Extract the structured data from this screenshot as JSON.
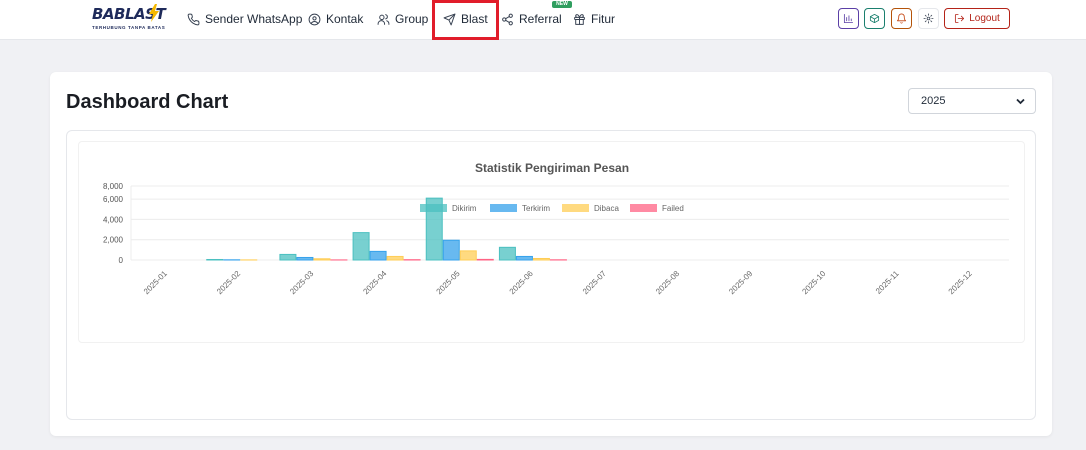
{
  "brand": {
    "name": "BABLAST",
    "tagline": "TERHUBUNG TANPA BATAS"
  },
  "nav": {
    "items": [
      {
        "label": "Sender WhatsApp",
        "icon": "phone-icon"
      },
      {
        "label": "Kontak",
        "icon": "user-circle-icon"
      },
      {
        "label": "Group",
        "icon": "users-icon"
      },
      {
        "label": "Blast",
        "icon": "send-icon"
      },
      {
        "label": "Referral",
        "icon": "share-icon"
      },
      {
        "label": "Fitur",
        "icon": "gift-icon"
      }
    ],
    "new_badge": "NEW"
  },
  "toolbar": {
    "chart_icon": "bar-chart-icon",
    "package_icon": "package-icon",
    "bell_icon": "bell-icon",
    "settings_icon": "gear-icon",
    "logout_label": "Logout",
    "colors": {
      "chart": "#5b3fa6",
      "package": "#1a7f6e",
      "bell": "#b45309",
      "settings": "#374151",
      "logout": "#b42318"
    }
  },
  "dashboard": {
    "title": "Dashboard Chart",
    "year_selected": "2025"
  },
  "chart_data": {
    "type": "bar",
    "title": "Statistik Pengiriman Pesan",
    "categories": [
      "2025-01",
      "2025-02",
      "2025-03",
      "2025-04",
      "2025-05",
      "2025-06",
      "2025-07",
      "2025-08",
      "2025-09",
      "2025-10",
      "2025-11",
      "2025-12"
    ],
    "series": [
      {
        "name": "Dikirim",
        "color": "#4bc0c0",
        "values": [
          0,
          50,
          550,
          2700,
          6100,
          1250,
          0,
          0,
          0,
          0,
          0,
          0
        ]
      },
      {
        "name": "Terkirim",
        "color": "#36a2eb",
        "values": [
          0,
          20,
          250,
          850,
          1950,
          350,
          0,
          0,
          0,
          0,
          0,
          0
        ]
      },
      {
        "name": "Dibaca",
        "color": "#ffcd56",
        "values": [
          0,
          10,
          120,
          350,
          900,
          150,
          0,
          0,
          0,
          0,
          0,
          0
        ]
      },
      {
        "name": "Failed",
        "color": "#ff6384",
        "values": [
          0,
          0,
          10,
          30,
          60,
          20,
          0,
          0,
          0,
          0,
          0,
          0
        ]
      }
    ],
    "yticks": [
      "0",
      "2,000",
      "4,000",
      "6,000",
      "8,000"
    ],
    "ylim": [
      0,
      7000
    ],
    "legend_position": "top",
    "grid": true
  }
}
